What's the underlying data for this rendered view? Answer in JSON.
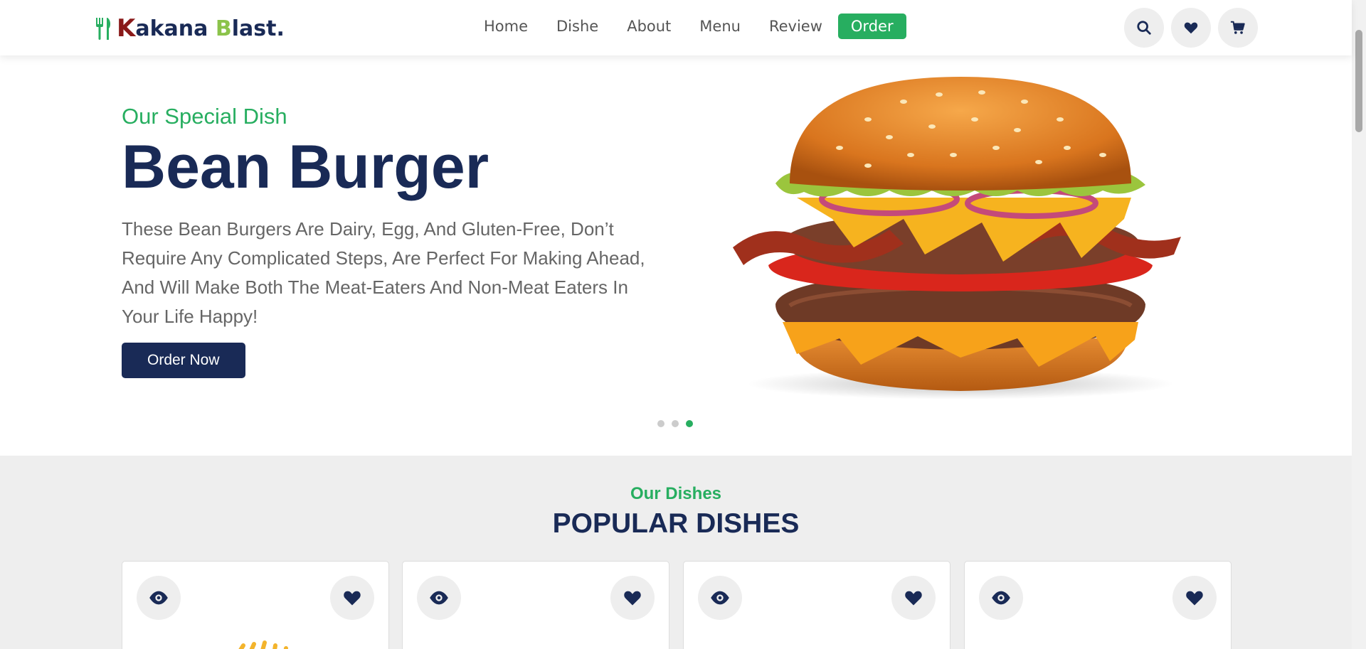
{
  "brand": {
    "logo_letter_k": "K",
    "logo_rest1": "akana ",
    "logo_letter_b": "B",
    "logo_rest2": "last."
  },
  "nav": {
    "items": [
      "Home",
      "Dishe",
      "About",
      "Menu",
      "Review"
    ],
    "order_label": "Order"
  },
  "header_icons": [
    "search-icon",
    "heart-icon",
    "cart-icon"
  ],
  "hero": {
    "subtitle": "Our Special Dish",
    "title": "Bean Burger",
    "description": "These Bean Burgers Are Dairy, Egg, And Gluten-Free, Don’t Require Any Complicated Steps, Are Perfect For Making Ahead, And Will Make Both The Meat-Eaters And Non-Meat Eaters In Your Life Happy!",
    "cta": "Order Now",
    "slides_count": 3,
    "active_slide": 3
  },
  "dishes": {
    "subtitle": "Our Dishes",
    "title": "POPULAR DISHES",
    "cards": [
      {
        "id": 1
      },
      {
        "id": 2
      },
      {
        "id": 3
      },
      {
        "id": 4
      }
    ]
  },
  "colors": {
    "primary": "#192a56",
    "accent": "#27ae60",
    "logo_k": "#8a1a1a",
    "logo_b": "#8bc34a"
  }
}
